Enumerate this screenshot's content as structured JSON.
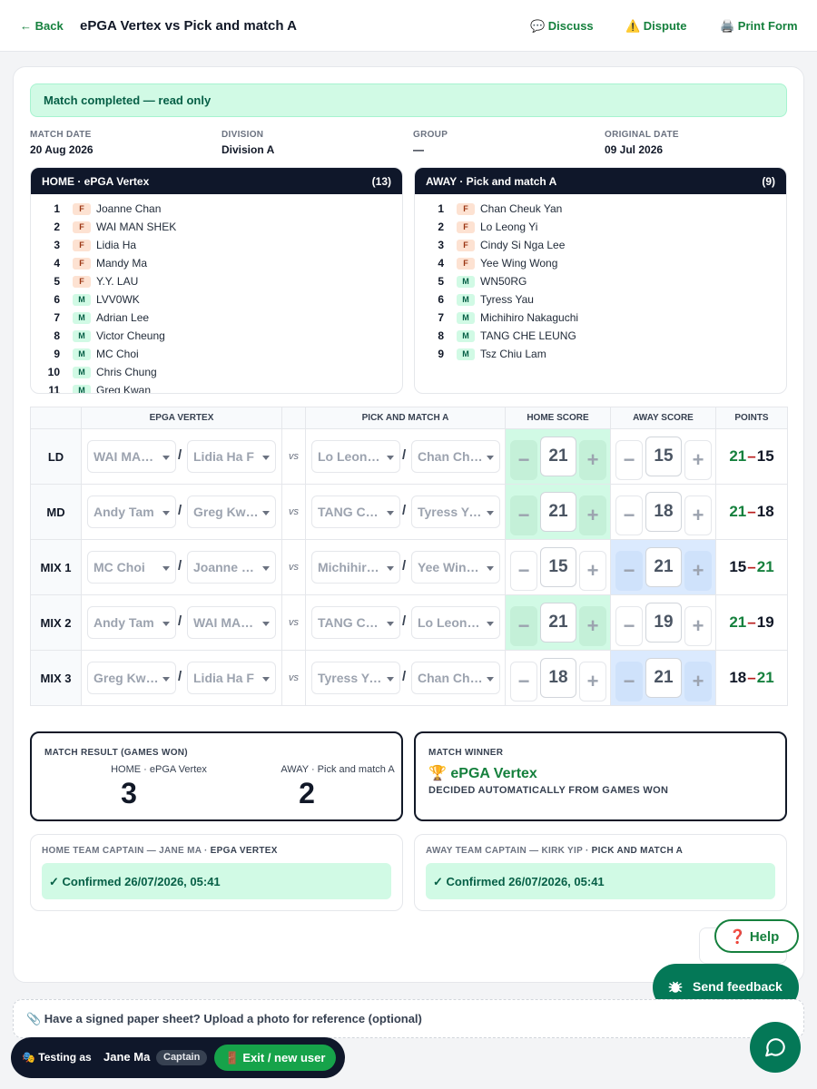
{
  "header": {
    "back_label": "← Back",
    "title": "ePGA Vertex vs Pick and match A",
    "discuss_label": "💬 Discuss",
    "dispute_label": "⚠️ Dispute",
    "print_label": "🖨️ Print Form"
  },
  "banner": "Match completed — read only",
  "meta": [
    {
      "label": "MATCH DATE",
      "value": "20 Aug 2026"
    },
    {
      "label": "DIVISION",
      "value": "Division A"
    },
    {
      "label": "GROUP",
      "value": "—"
    },
    {
      "label": "ORIGINAL DATE",
      "value": "09 Jul 2026"
    }
  ],
  "home_roster": {
    "title": "HOME · ePGA Vertex",
    "count": "(13)",
    "players": [
      {
        "n": "1",
        "g": "F",
        "name": "Joanne Chan"
      },
      {
        "n": "2",
        "g": "F",
        "name": "WAI MAN SHEK"
      },
      {
        "n": "3",
        "g": "F",
        "name": "Lidia Ha"
      },
      {
        "n": "4",
        "g": "F",
        "name": "Mandy Ma"
      },
      {
        "n": "5",
        "g": "F",
        "name": "Y.Y. LAU"
      },
      {
        "n": "6",
        "g": "M",
        "name": "LVV0WK"
      },
      {
        "n": "7",
        "g": "M",
        "name": "Adrian Lee"
      },
      {
        "n": "8",
        "g": "M",
        "name": "Victor Cheung"
      },
      {
        "n": "9",
        "g": "M",
        "name": "MC Choi"
      },
      {
        "n": "10",
        "g": "M",
        "name": "Chris Chung"
      },
      {
        "n": "11",
        "g": "M",
        "name": "Greg Kwan"
      }
    ]
  },
  "away_roster": {
    "title": "AWAY · Pick and match A",
    "count": "(9)",
    "players": [
      {
        "n": "1",
        "g": "F",
        "name": "Chan Cheuk Yan"
      },
      {
        "n": "2",
        "g": "F",
        "name": "Lo Leong Yi"
      },
      {
        "n": "3",
        "g": "F",
        "name": "Cindy Si Nga Lee"
      },
      {
        "n": "4",
        "g": "F",
        "name": "Yee Wing Wong"
      },
      {
        "n": "5",
        "g": "M",
        "name": "WN50RG"
      },
      {
        "n": "6",
        "g": "M",
        "name": "Tyress Yau"
      },
      {
        "n": "7",
        "g": "M",
        "name": "Michihiro Nakaguchi"
      },
      {
        "n": "8",
        "g": "M",
        "name": "TANG CHE LEUNG"
      },
      {
        "n": "9",
        "g": "M",
        "name": "Tsz Chiu Lam"
      }
    ]
  },
  "games_table": {
    "headers": [
      "",
      "EPGA VERTEX",
      "",
      "PICK AND MATCH A",
      "HOME SCORE",
      "AWAY SCORE",
      "POINTS"
    ],
    "vs": "vs",
    "slash": "/",
    "minus": "−",
    "plus": "+",
    "dash": "–",
    "rows": [
      {
        "label": "LD",
        "h1": "WAI MAN SHEK",
        "h2": "Lidia Ha F",
        "a1": "Lo Leong Yi",
        "a2": "Chan Cheuk Yan",
        "hs": "21",
        "as": "15",
        "winner": "home"
      },
      {
        "label": "MD",
        "h1": "Andy Tam",
        "h2": "Greg Kwan",
        "a1": "TANG CHE LEUNG",
        "a2": "Tyress Yau",
        "hs": "21",
        "as": "18",
        "winner": "home"
      },
      {
        "label": "MIX 1",
        "h1": "MC Choi",
        "h2": "Joanne Chan",
        "a1": "Michihiro Nakaguchi",
        "a2": "Yee Wing Wong",
        "hs": "15",
        "as": "21",
        "winner": "away"
      },
      {
        "label": "MIX 2",
        "h1": "Andy Tam",
        "h2": "WAI MAN SHEK",
        "a1": "TANG CHE LEUNG",
        "a2": "Lo Leong Yi",
        "hs": "21",
        "as": "19",
        "winner": "home"
      },
      {
        "label": "MIX 3",
        "h1": "Greg Kwan",
        "h2": "Lidia Ha F",
        "a1": "Tyress Yau",
        "a2": "Chan Cheuk Yan",
        "hs": "18",
        "as": "21",
        "winner": "away"
      }
    ]
  },
  "result": {
    "label": "MATCH RESULT (GAMES WON)",
    "home_label": "HOME · ePGA Vertex",
    "home_games": "3",
    "away_label": "AWAY · Pick and match A",
    "away_games": "2"
  },
  "winner": {
    "label": "MATCH WINNER",
    "name": "🏆 ePGA Vertex",
    "note": "DECIDED AUTOMATICALLY FROM GAMES WON"
  },
  "captains": {
    "home_label": "HOME TEAM CAPTAIN — JANE MA · ",
    "home_team": "EPGA VERTEX",
    "home_status": "✓ Confirmed 26/07/2026, 05:41",
    "away_label": "AWAY TEAM CAPTAIN — KIRK YIP · ",
    "away_team": "PICK AND MATCH A",
    "away_status": "✓ Confirmed 26/07/2026, 05:41"
  },
  "help_label": "❓ Help",
  "feedback_label": "Send feedback",
  "upload_label": "📎 Have a signed paper sheet? Upload a photo for reference (optional)",
  "testing": {
    "prefix": "🎭 Testing as",
    "name": "Jane Ma",
    "role": "Captain",
    "exit_label": "🚪 Exit / new user"
  },
  "colors": {
    "accent": "#15803d",
    "home_win": "#d1fae5",
    "away_win": "#dbeafe",
    "dark": "#0f172a"
  },
  "icons": {
    "feedback": "bug-icon",
    "chat": "chat-bubble-icon"
  }
}
